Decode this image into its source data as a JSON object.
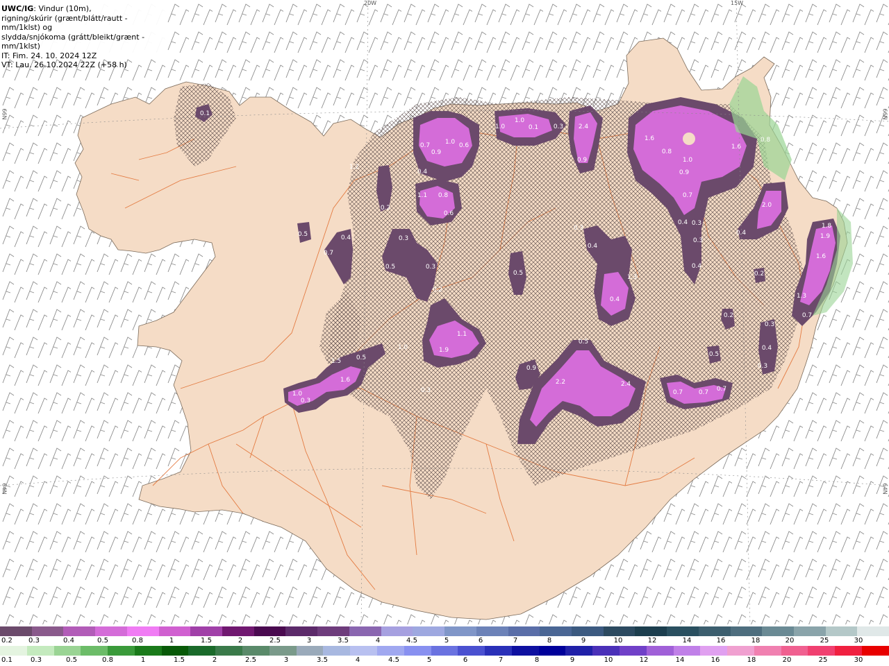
{
  "header": {
    "model": "UWC/IG",
    "line1": ": Vindur (10m),",
    "line2": "rigning/skúrir (grænt/blátt/rautt - mm/1klst) og",
    "line3": "slydda/snjókoma (grátt/bleikt/grænt - mm/1klst)",
    "line4": "IT: Fim. 24. 10. 2024 12Z",
    "line5": "VT: Lau. 26.10.2024 22Z (+58 h)"
  },
  "grid_labels": {
    "top_left_lon": "20W",
    "top_right_lon": "15W",
    "left_upper_lat": "66N",
    "right_upper_lat": "66N",
    "left_lower_lat": "64N",
    "right_lower_lat": "64N"
  },
  "precip_labels": [
    "0.1",
    "1.2",
    "0.2",
    "0.5",
    "0.4",
    "0.7",
    "0.3",
    "0.5",
    "0.3",
    "0.2",
    "1.1",
    "0.8",
    "0.6",
    "0.7",
    "0.9",
    "1.0",
    "0.4",
    "0.6",
    "1.0",
    "1.0",
    "0.1",
    "0.3",
    "2.4",
    "0.9",
    "1.6",
    "0.8",
    "1.0",
    "0.9",
    "0.7",
    "0.4",
    "0.3",
    "0.3",
    "0.4",
    "1.6",
    "0.8",
    "2.0",
    "0.4",
    "0.5",
    "0.3",
    "0.4",
    "1.3",
    "0.4",
    "0.2",
    "0.2",
    "0.5",
    "0.3",
    "0.4",
    "0.3",
    "1.8",
    "1.9",
    "1.6",
    "1.3",
    "0.7",
    "1.1",
    "1.9",
    "0.3",
    "1.5",
    "1.6",
    "1.0",
    "0.3",
    "0.5",
    "2.2",
    "2.4",
    "0.9",
    "0.7",
    "0.7",
    "0.7",
    "0.5",
    "1.0"
  ],
  "legend_snow": {
    "colors": [
      "#6b4a6b",
      "#8a5a8c",
      "#b25cb8",
      "#d46cd8",
      "#f07cf4",
      "#d060d0",
      "#a040a8",
      "#701870",
      "#4a0a50",
      "#5c2a6a",
      "#6e3c7c",
      "#8a66b0",
      "#a6a0e0",
      "#9ea8e0",
      "#8096c8",
      "#6c82b8",
      "#5a6ea8",
      "#4a6694",
      "#3c5a80",
      "#2c4a60",
      "#1c3e4e",
      "#2a5060",
      "#3c5e6e",
      "#4e6e7e",
      "#6a8a94",
      "#8aa4aa",
      "#b4c8c8",
      "#e0e8e8"
    ],
    "labels": [
      "0.2",
      "0.3",
      "0.4",
      "0.5",
      "0.8",
      "1",
      "1.5",
      "2",
      "2.5",
      "3",
      "3.5",
      "4",
      "4.5",
      "5",
      "6",
      "7",
      "8",
      "9",
      "10",
      "12",
      "14",
      "16",
      "18",
      "20",
      "25",
      "30"
    ]
  },
  "legend_rain": {
    "colors": [
      "#e4f4e0",
      "#c4eabe",
      "#9ad494",
      "#6cbc68",
      "#3a9a3a",
      "#1a7a1a",
      "#085a08",
      "#1a6a2a",
      "#3a7a4a",
      "#5a8a6a",
      "#7a9a8a",
      "#9aaaba",
      "#a8b8e0",
      "#b8c0f0",
      "#a0a8f0",
      "#8890f0",
      "#6a72e0",
      "#4a50d0",
      "#2a30b8",
      "#0e10a0",
      "#00009a",
      "#2020a8",
      "#4a30b8",
      "#7040c8",
      "#a060d8",
      "#c080e8",
      "#e0a0f0",
      "#f0a0d0",
      "#f080b0",
      "#f06090",
      "#f04070",
      "#f02040",
      "#e80000"
    ],
    "labels": [
      "0.1",
      "0.3",
      "0.5",
      "0.8",
      "1",
      "1.5",
      "2",
      "2.5",
      "3",
      "3.5",
      "4",
      "4.5",
      "5",
      "6",
      "7",
      "8",
      "9",
      "10",
      "12",
      "14",
      "16",
      "18",
      "20",
      "25",
      "30"
    ]
  }
}
